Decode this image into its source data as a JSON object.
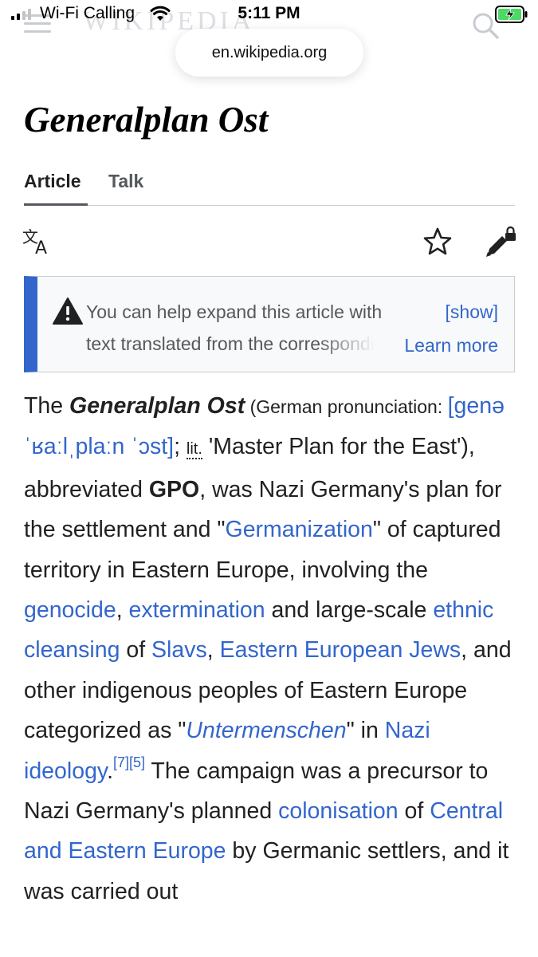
{
  "status_bar": {
    "carrier": "Wi-Fi Calling",
    "time": "5:11 PM"
  },
  "browser": {
    "url": "en.wikipedia.org"
  },
  "header": {
    "wordmark": "WIKIPEDIA"
  },
  "article": {
    "title": "Generalplan Ost",
    "tabs": [
      {
        "label": "Article",
        "active": true
      },
      {
        "label": "Talk",
        "active": false
      }
    ]
  },
  "notice": {
    "line1": "You can help expand this article with",
    "line2": "text translated from the corresponding article in German",
    "show_label": "[show]",
    "learn_more_label": "Learn more"
  },
  "content": {
    "p1_the": "The ",
    "p1_title": "Generalplan Ost",
    "p1_pron_open": " (",
    "p1_pron_label": "German pronunciation: ",
    "p1_ipa": "[genəˈʁaːlˌplaːn ˈɔst]",
    "p1_semicolon": "; ",
    "p1_lit": "lit.",
    "p1_lit_text": " 'Master Plan for the East'), abbreviated ",
    "p1_gpo": "GPO",
    "p1_t1": ", was Nazi Germany's plan for the settlement and \"",
    "link_germanization": "Germanization",
    "p1_t2": "\" of captured territory in Eastern Europe, involving the ",
    "link_genocide": "genocide",
    "p1_t3": ", ",
    "link_extermination": "extermination",
    "p1_t4": " and large-scale ",
    "link_ethnic_cleansing": "ethnic cleansing",
    "p1_t5": " of ",
    "link_slavs": "Slavs",
    "p1_t6": ", ",
    "link_eastern_jews": "Eastern European Jews",
    "p1_t7": ", and other indigenous peoples of Eastern Europe categorized as \"",
    "link_untermenschen": "Untermenschen",
    "p1_t8": "\" in ",
    "link_nazi_ideology": "Nazi ideology",
    "p1_t9": ".",
    "ref7": "[7]",
    "ref5": "[5]",
    "p1_t10": " The campaign was a precursor to Nazi Germany's planned ",
    "link_colonisation": "colonisation",
    "p1_t11": " of ",
    "link_central_eastern_europe": "Central and Eastern Europe",
    "p1_t12": " by Germanic settlers, and it was carried out"
  },
  "colors": {
    "link": "#3366cc",
    "notice_bar": "#3366cc",
    "text": "#202122"
  }
}
